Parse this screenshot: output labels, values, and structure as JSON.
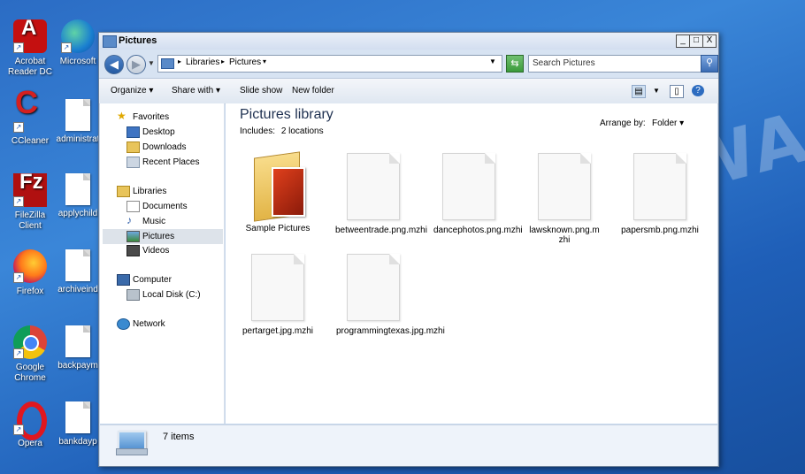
{
  "watermark": "ANTISPYWARE.CO",
  "desktop": {
    "icons": [
      {
        "label": "Acrobat Reader DC"
      },
      {
        "label": "Microsoft"
      },
      {
        "label": "CCleaner"
      },
      {
        "label": "administrat"
      },
      {
        "label": "FileZilla Client"
      },
      {
        "label": "applychild"
      },
      {
        "label": "Firefox"
      },
      {
        "label": "archiveind"
      },
      {
        "label": "Google Chrome"
      },
      {
        "label": "backpaym"
      },
      {
        "label": "Opera"
      },
      {
        "label": "bankdayp"
      }
    ]
  },
  "window": {
    "title": "Pictures",
    "controls": {
      "minimize": "_",
      "maximize": "□",
      "close": "X"
    },
    "address": {
      "crumb1": "Libraries",
      "crumb2": "Pictures"
    },
    "search_placeholder": "Search Pictures",
    "toolbar": {
      "organize": "Organize",
      "share": "Share with",
      "slideshow": "Slide show",
      "newfolder": "New folder"
    },
    "nav": {
      "favorites": "Favorites",
      "desktop": "Desktop",
      "downloads": "Downloads",
      "recent": "Recent Places",
      "libraries": "Libraries",
      "documents": "Documents",
      "music": "Music",
      "pictures": "Pictures",
      "videos": "Videos",
      "computer": "Computer",
      "localdisk": "Local Disk (C:)",
      "network": "Network"
    },
    "content": {
      "title": "Pictures library",
      "includes_label": "Includes:",
      "includes_link": "2 locations",
      "arrange_label": "Arrange by:",
      "arrange_value": "Folder",
      "items": [
        {
          "name": "Sample Pictures"
        },
        {
          "name": "betweentrade.png.mzhi"
        },
        {
          "name": "dancephotos.png.mzhi"
        },
        {
          "name": "lawsknown.png.mzhi"
        },
        {
          "name": "papersmb.png.mzhi"
        },
        {
          "name": "pertarget.jpg.mzhi"
        },
        {
          "name": "programmingtexas.jpg.mzhi"
        }
      ]
    },
    "status": {
      "count": "7 items"
    }
  }
}
